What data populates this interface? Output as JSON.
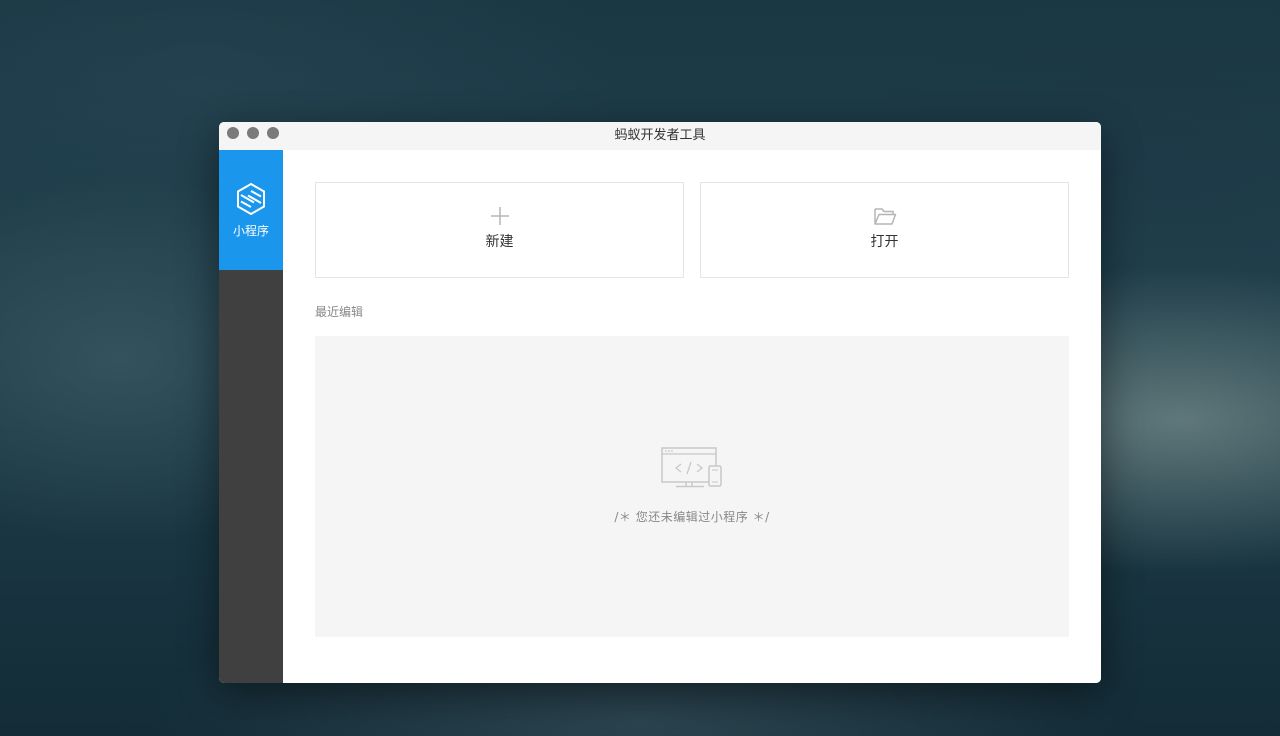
{
  "window": {
    "title": "蚂蚁开发者工具"
  },
  "sidebar": {
    "items": [
      {
        "label": "小程序",
        "icon": "mini-program-hexagon-icon",
        "active": true
      }
    ]
  },
  "actions": {
    "new_label": "新建",
    "new_icon": "plus-icon",
    "open_label": "打开",
    "open_icon": "folder-icon"
  },
  "recent": {
    "heading": "最近编辑",
    "empty_icon": "code-monitor-icon",
    "empty_text": "/＊ 您还未编辑过小程序 ＊/"
  },
  "colors": {
    "accent": "#1a96ec",
    "sidebar_bg": "#404040",
    "panel_bg": "#f5f5f5"
  }
}
